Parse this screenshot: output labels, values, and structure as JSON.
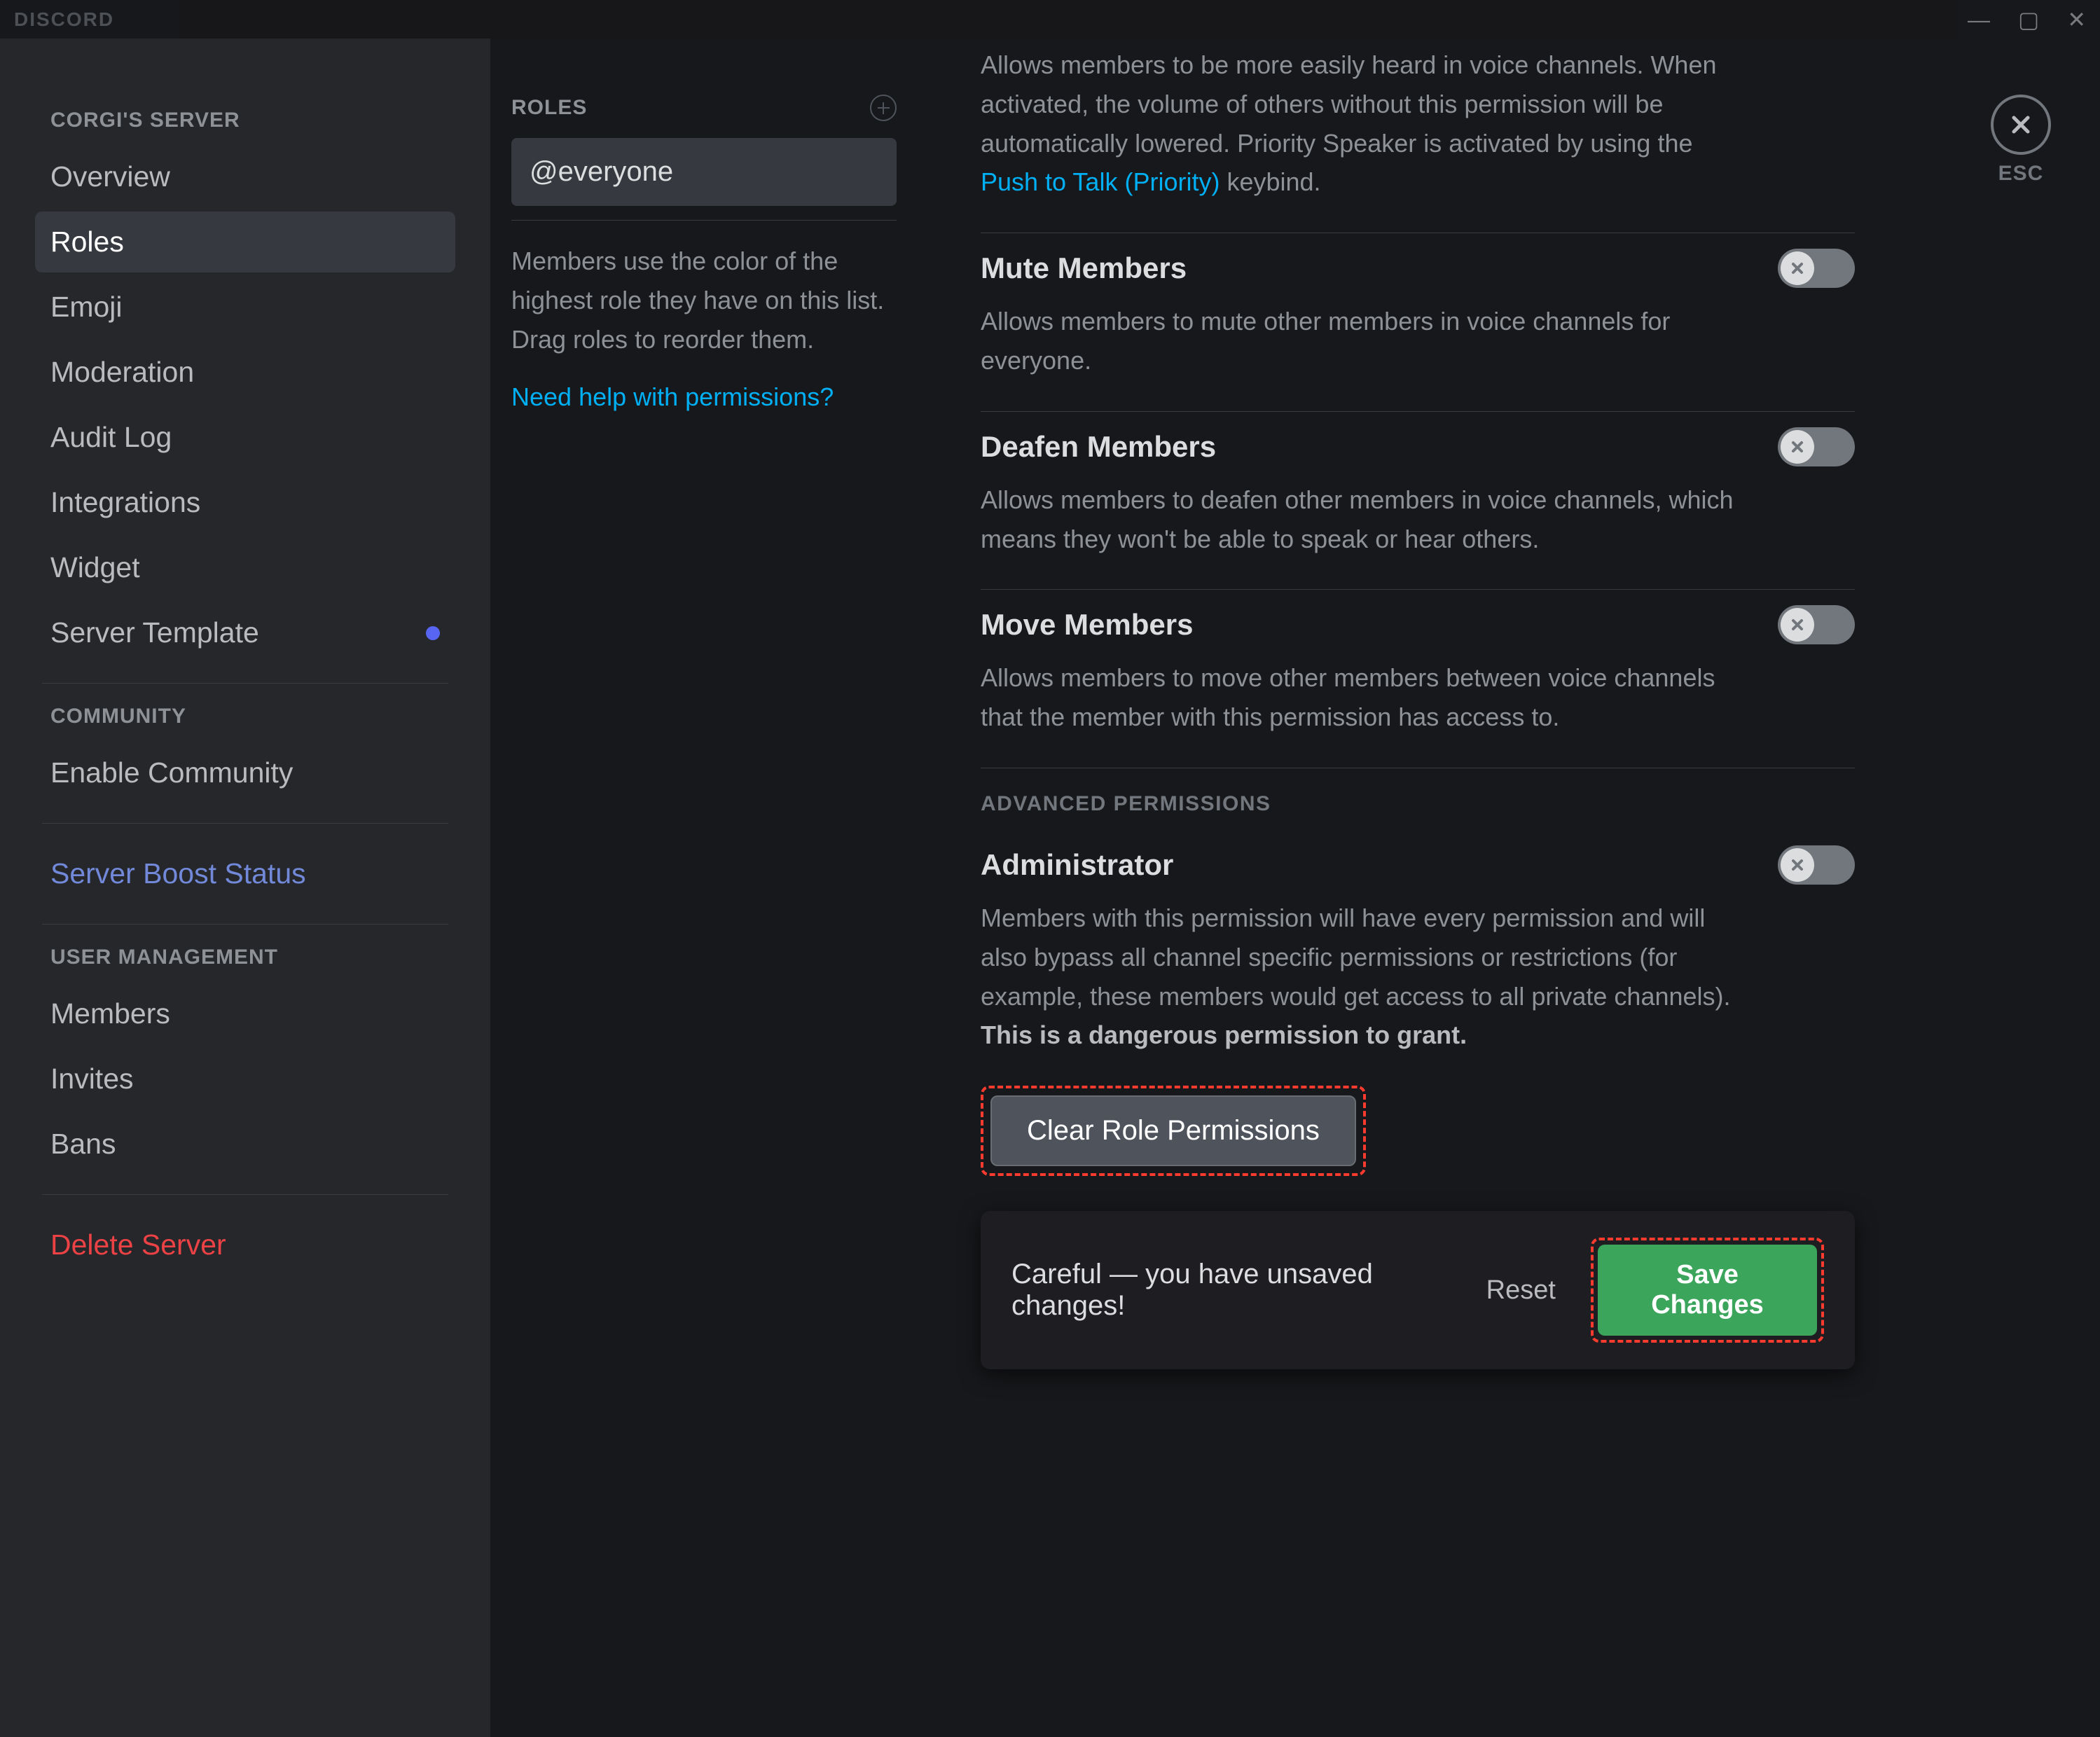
{
  "brand": "DISCORD",
  "window": {
    "esc_label": "ESC"
  },
  "sidebar": {
    "server_label": "CORGI'S SERVER",
    "items": [
      {
        "label": "Overview"
      },
      {
        "label": "Roles"
      },
      {
        "label": "Emoji"
      },
      {
        "label": "Moderation"
      },
      {
        "label": "Audit Log"
      },
      {
        "label": "Integrations"
      },
      {
        "label": "Widget"
      },
      {
        "label": "Server Template"
      }
    ],
    "community_label": "COMMUNITY",
    "community": [
      {
        "label": "Enable Community"
      }
    ],
    "boost": {
      "label": "Server Boost Status"
    },
    "user_label": "USER MANAGEMENT",
    "user": [
      {
        "label": "Members"
      },
      {
        "label": "Invites"
      },
      {
        "label": "Bans"
      }
    ],
    "delete": {
      "label": "Delete Server"
    }
  },
  "roles": {
    "header": "ROLES",
    "selected": "@everyone",
    "helper": "Members use the color of the highest role they have on this list. Drag roles to reorder them.",
    "help_link": "Need help with permissions?"
  },
  "permissions": {
    "priority_speaker_desc_prefix": "Allows members to be more easily heard in voice channels. When activated, the volume of others without this permission will be automatically lowered. Priority Speaker is activated by using the ",
    "priority_speaker_keybind": "Push to Talk (Priority)",
    "priority_speaker_desc_suffix": " keybind.",
    "mute": {
      "title": "Mute Members",
      "desc": "Allows members to mute other members in voice channels for everyone."
    },
    "deafen": {
      "title": "Deafen Members",
      "desc": "Allows members to deafen other members in voice channels, which means they won't be able to speak or hear others."
    },
    "move": {
      "title": "Move Members",
      "desc": "Allows members to move other members between voice channels that the member with this permission has access to."
    },
    "advanced_heading": "ADVANCED PERMISSIONS",
    "admin": {
      "title": "Administrator",
      "desc": "Members with this permission will have every permission and will also bypass all channel specific permissions or restrictions (for example, these members would get access to all private channels). ",
      "warn": "This is a dangerous permission to grant."
    },
    "clear_button": "Clear Role Permissions"
  },
  "savebar": {
    "message": "Careful — you have unsaved changes!",
    "reset": "Reset",
    "save": "Save Changes"
  }
}
